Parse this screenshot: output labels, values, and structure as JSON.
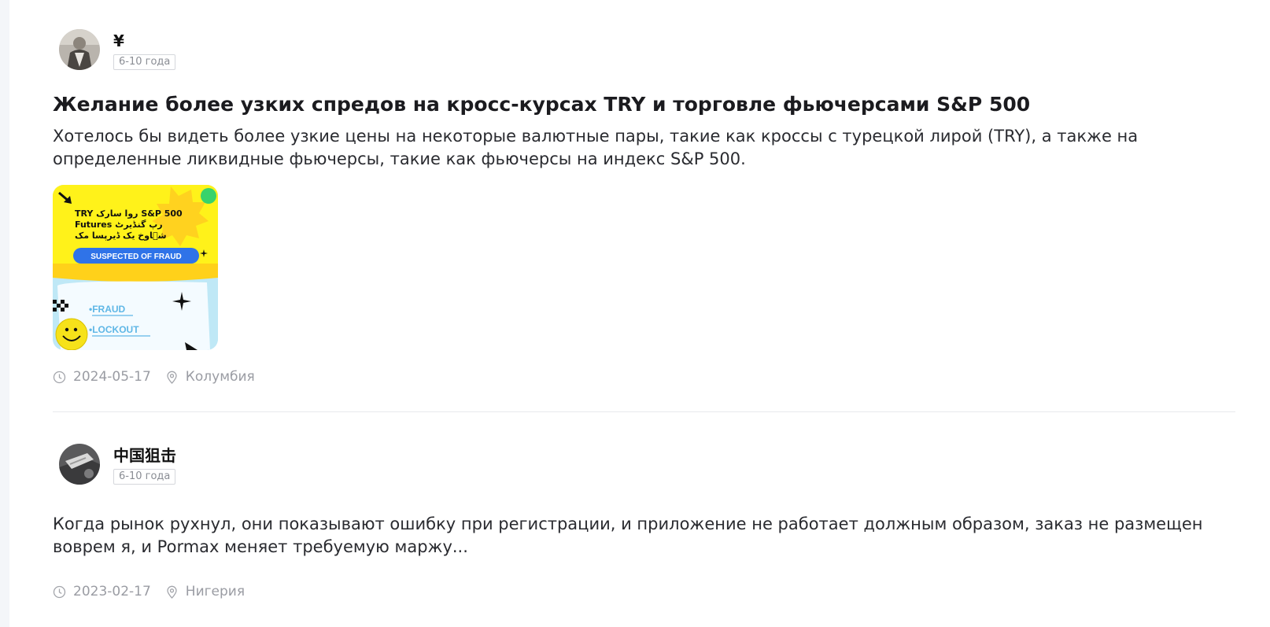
{
  "posts": [
    {
      "author_name": "¥",
      "tenure": "6-10 года",
      "title": "Желание более узких спредов на кросс-курсах TRY и торговле фьючерсами S&P 500",
      "body": "Хотелось бы видеть более узкие цены на некоторые валютные пары, такие как кроссы с турецкой лирой (TRY), а также на определенные ликвидные фьючерсы, такие как фьючерсы на индекс S&P 500.",
      "image": {
        "line1": "TRY روا سارک S&P 500",
        "line2": "Futures رپ گنڈیرٹ",
        "line3": "ش٘اوخ یک ڈیرپسا مک",
        "banner": "SUSPECTED OF FRAUD",
        "tag1": "•FRAUD",
        "tag2": "•LOCKOUT"
      },
      "date": "2024-05-17",
      "location": "Колумбия"
    },
    {
      "author_name": "中国狙击",
      "tenure": "6-10 года",
      "body": "Когда рынок рухнул, они показывают ошибку при регистрации, и приложение не работает должным образом, заказ не размещен воврем я, и Pormax меняет требуемую маржу...",
      "date": "2023-02-17",
      "location": "Нигерия"
    }
  ],
  "icons": {
    "date": "clock-icon",
    "location": "location-pin-icon"
  }
}
